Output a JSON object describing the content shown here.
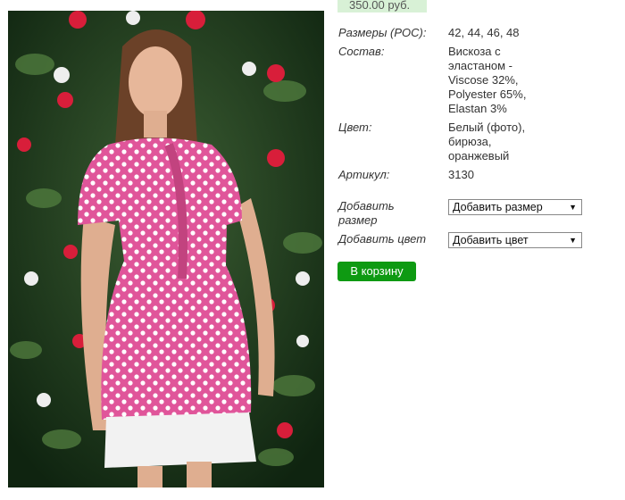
{
  "product": {
    "price": "350.00 руб.",
    "image_alt": "pink polka-dot blouse on model in front of rose wall"
  },
  "details": [
    {
      "label": "Размеры (РОС):",
      "value": "42, 44, 46, 48"
    },
    {
      "label": "Состав:",
      "value": "Вискоза с эластаном - Viscose 32%, Polyester 65%, Elastan 3%"
    },
    {
      "label": "Цвет:",
      "value": "Белый (фото), бирюза, оранжевый"
    },
    {
      "label": "Артикул:",
      "value": "3130"
    }
  ],
  "options": {
    "size_label": "Добавить размер",
    "size_select": "Добавить размер",
    "color_label": "Добавить цвет",
    "color_select": "Добавить цвет"
  },
  "cart_button": "В корзину",
  "colors": {
    "price_bg": "#d8f1d6",
    "button_green": "#0e9a12",
    "blouse_pink": "#e0559a"
  }
}
